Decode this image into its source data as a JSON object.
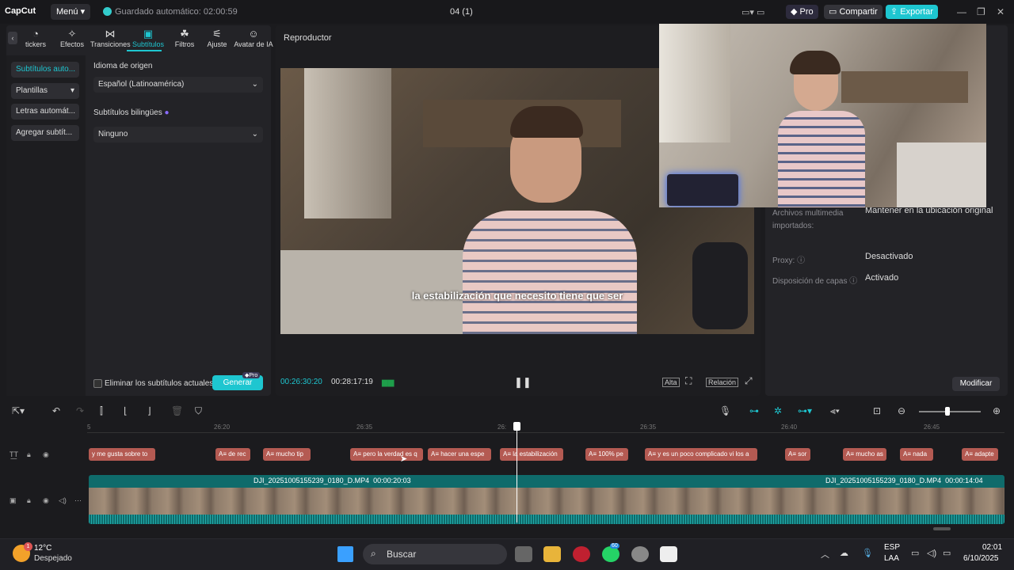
{
  "app": {
    "logo": "CapCut",
    "menu_label": "Menú",
    "autosave": "Guardado automático: 02:00:59",
    "project_title": "04 (1)",
    "pro_label": "Pro",
    "share_label": "Compartir",
    "export_label": "Exportar"
  },
  "tabs": [
    {
      "label": "tickers",
      "icon": "sticker-icon"
    },
    {
      "label": "Efectos",
      "icon": "effects-icon"
    },
    {
      "label": "Transiciones",
      "icon": "transitions-icon"
    },
    {
      "label": "Subtítulos",
      "icon": "subtitles-icon"
    },
    {
      "label": "Filtros",
      "icon": "filters-icon"
    },
    {
      "label": "Ajuste",
      "icon": "adjust-icon"
    },
    {
      "label": "Avatar de IA",
      "icon": "avatar-icon"
    }
  ],
  "sidenav": [
    "Subtítulos auto...",
    "Plantillas",
    "Letras automát...",
    "Agregar subtít..."
  ],
  "captions": {
    "source_lang_label": "Idioma de origen",
    "source_lang_value": "Español (Latinoamérica)",
    "bilingual_label": "Subtítulos bilingües",
    "bilingual_value": "Ninguno",
    "remove_label": "Eliminar los subtítulos actuales",
    "generate_label": "Generar",
    "pro_badge": "Pro"
  },
  "player": {
    "title": "Reproductor",
    "subtitle": "la estabilización que necesito tiene que ser",
    "current_time": "00:26:30:20",
    "total_time": "00:28:17:19",
    "quality": "Alta",
    "ratio": "Relación"
  },
  "details": {
    "rows": [
      {
        "key": "Archivos multimedia importados:",
        "value": "Mantener en la ubicación original"
      },
      {
        "key": "Proxy:",
        "value": "Desactivado"
      },
      {
        "key": "Disposición de capas",
        "value": "Activado"
      }
    ],
    "modify_label": "Modificar"
  },
  "ruler": [
    "5",
    "26:20",
    "26:35",
    "26:",
    "26:35",
    "26:40",
    "26:45"
  ],
  "subtitle_clips": [
    "y me gusta sobre to",
    "de rec",
    "mucho tip",
    "pero la verdad es q",
    "hacer una espe",
    "la estabilización",
    "100% pe",
    "y es un poco complicado vi los a",
    "sor",
    "mucho as",
    "nada",
    "adapte"
  ],
  "video_clips": [
    {
      "name": "DJI_20251005155239_0180_D.MP4",
      "duration": "00:00:20:03"
    },
    {
      "name": "DJI_20251005155239_0180_D.MP4",
      "duration": "00:00:14:04"
    }
  ],
  "taskbar": {
    "weather_temp": "12°C",
    "weather_desc": "Despejado",
    "weather_badge": "1",
    "search_label": "Buscar",
    "whatsapp_badge": "60",
    "lang1": "ESP",
    "lang2": "LAA",
    "time": "02:01",
    "date": "6/10/2025"
  },
  "colors": {
    "accent": "#1ec6d0",
    "subtitle_clip": "#b45a52",
    "video_track": "#0f6b6b"
  }
}
